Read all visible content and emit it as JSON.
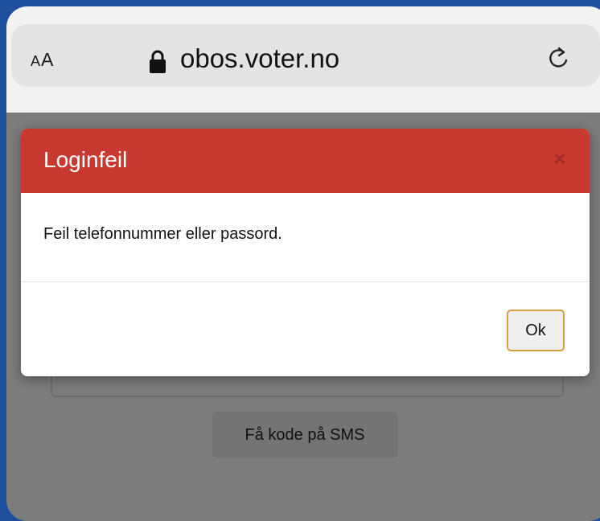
{
  "browser": {
    "text_size_small": "A",
    "text_size_large": "A",
    "url": "obos.voter.no"
  },
  "dialog": {
    "title": "Loginfeil",
    "close_label": "×",
    "message": "Feil telefonnummer eller passord.",
    "ok_label": "Ok"
  },
  "page": {
    "sms_button_label": "Få kode på SMS"
  },
  "colors": {
    "dialog_header": "#c8392f",
    "ok_focus_border": "#d9a13b",
    "overlay": "#7c7c7c"
  }
}
